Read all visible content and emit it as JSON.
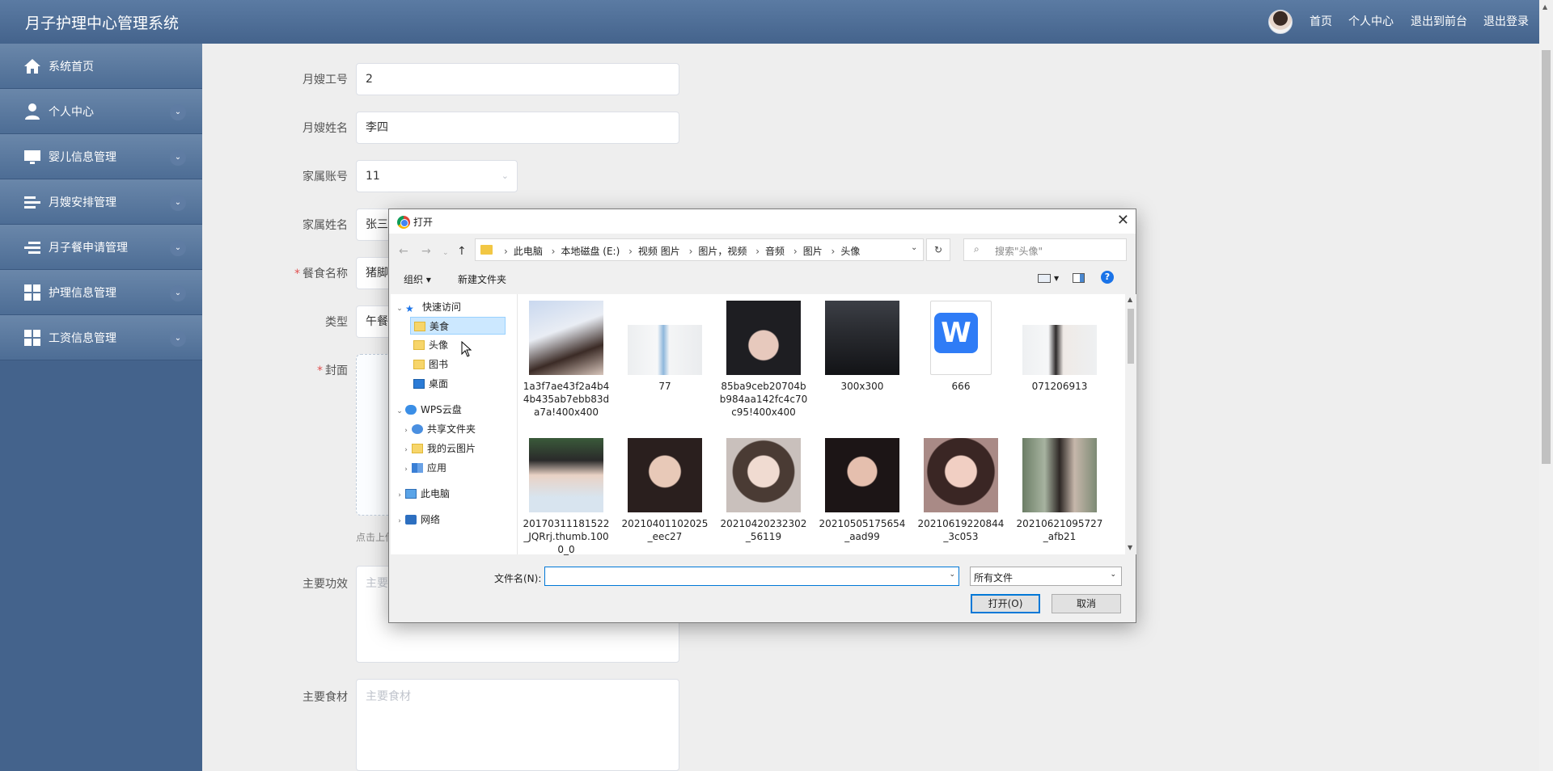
{
  "app": {
    "title": "月子护理中心管理系统",
    "nav": [
      "首页",
      "个人中心",
      "退出到前台",
      "退出登录"
    ]
  },
  "sidebar": {
    "items": [
      {
        "label": "系统首页",
        "icon": "home-icon"
      },
      {
        "label": "个人中心",
        "icon": "user-icon"
      },
      {
        "label": "婴儿信息管理",
        "icon": "monitor-icon"
      },
      {
        "label": "月嫂安排管理",
        "icon": "list-icon"
      },
      {
        "label": "月子餐申请管理",
        "icon": "list-icon"
      },
      {
        "label": "护理信息管理",
        "icon": "grid-icon"
      },
      {
        "label": "工资信息管理",
        "icon": "grid-icon"
      }
    ]
  },
  "form": {
    "labels": {
      "nanny_no": "月嫂工号",
      "nanny_name": "月嫂姓名",
      "family_account": "家属账号",
      "family_name": "家属姓名",
      "meal_name": "餐食名称",
      "type": "类型",
      "cover": "封面",
      "effects": "主要功效",
      "ingredients": "主要食材"
    },
    "values": {
      "nanny_no": "2",
      "nanny_name": "李四",
      "family_account": "11",
      "family_name": "张三",
      "meal_name": "猪脚",
      "type": "午餐"
    },
    "upload_hint": "点击上传",
    "effects_placeholder": "主要",
    "ingredients_placeholder": "主要食材"
  },
  "dialog": {
    "title": "打开",
    "breadcrumb": [
      "此电脑",
      "本地磁盘 (E:)",
      "视频 图片",
      "图片，视频",
      "音频",
      "图片",
      "头像"
    ],
    "search_placeholder": "搜索\"头像\"",
    "toolbar": {
      "organize": "组织 ▾",
      "new_folder": "新建文件夹"
    },
    "tree": {
      "quick_access": "快速访问",
      "food": "美食",
      "avatar": "头像",
      "books": "图书",
      "desktop": "桌面",
      "wps": "WPS云盘",
      "shared": "共享文件夹",
      "my_cloud_pics": "我的云图片",
      "apps": "应用",
      "this_pc": "此电脑",
      "network": "网络"
    },
    "files": [
      {
        "name": "1a3f7ae43f2a4b44b435ab7ebb83da7a!400x400"
      },
      {
        "name": "77"
      },
      {
        "name": "85ba9ceb20704bb984aa142fc4c70c95!400x400"
      },
      {
        "name": "300x300"
      },
      {
        "name": "666"
      },
      {
        "name": "071206913"
      },
      {
        "name": "20170311181522_JQRrj.thumb.1000_0"
      },
      {
        "name": "20210401102025_eec27"
      },
      {
        "name": "20210420232302_56119"
      },
      {
        "name": "20210505175654_aad99"
      },
      {
        "name": "20210619220844_3c053"
      },
      {
        "name": "20210621095727_afb21"
      }
    ],
    "filename_label": "文件名(N):",
    "filename_value": "",
    "filetype": "所有文件",
    "open_button": "打开(O)",
    "cancel_button": "取消"
  }
}
